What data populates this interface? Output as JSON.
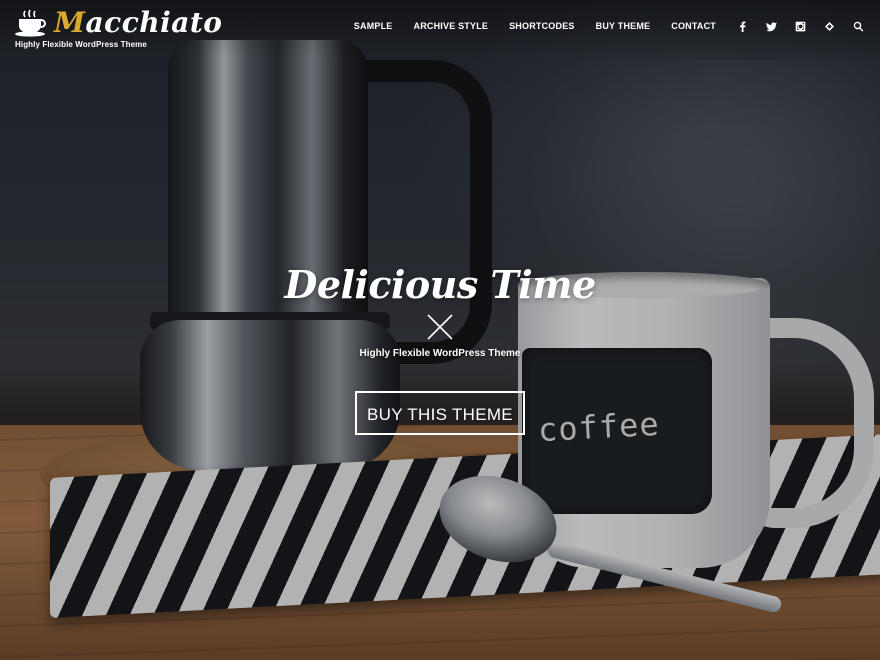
{
  "site": {
    "logo_initial": "M",
    "logo_rest": "acchiato",
    "tagline": "Highly Flexible WordPress Theme"
  },
  "nav": {
    "links": [
      "SAMPLE",
      "ARCHIVE STYLE",
      "SHORTCODES",
      "BUY THEME",
      "CONTACT"
    ],
    "icons": [
      "facebook-icon",
      "twitter-icon",
      "instagram-icon",
      "feedly-icon",
      "search-icon"
    ]
  },
  "hero": {
    "title": "Delicious Time",
    "subtitle": "Highly Flexible WordPress Theme",
    "button_label": "BUY THIS THEME"
  },
  "scene": {
    "cup_chalk_text": "coffee"
  },
  "colors": {
    "logo_accent": "#d9a930",
    "text": "#ffffff"
  }
}
